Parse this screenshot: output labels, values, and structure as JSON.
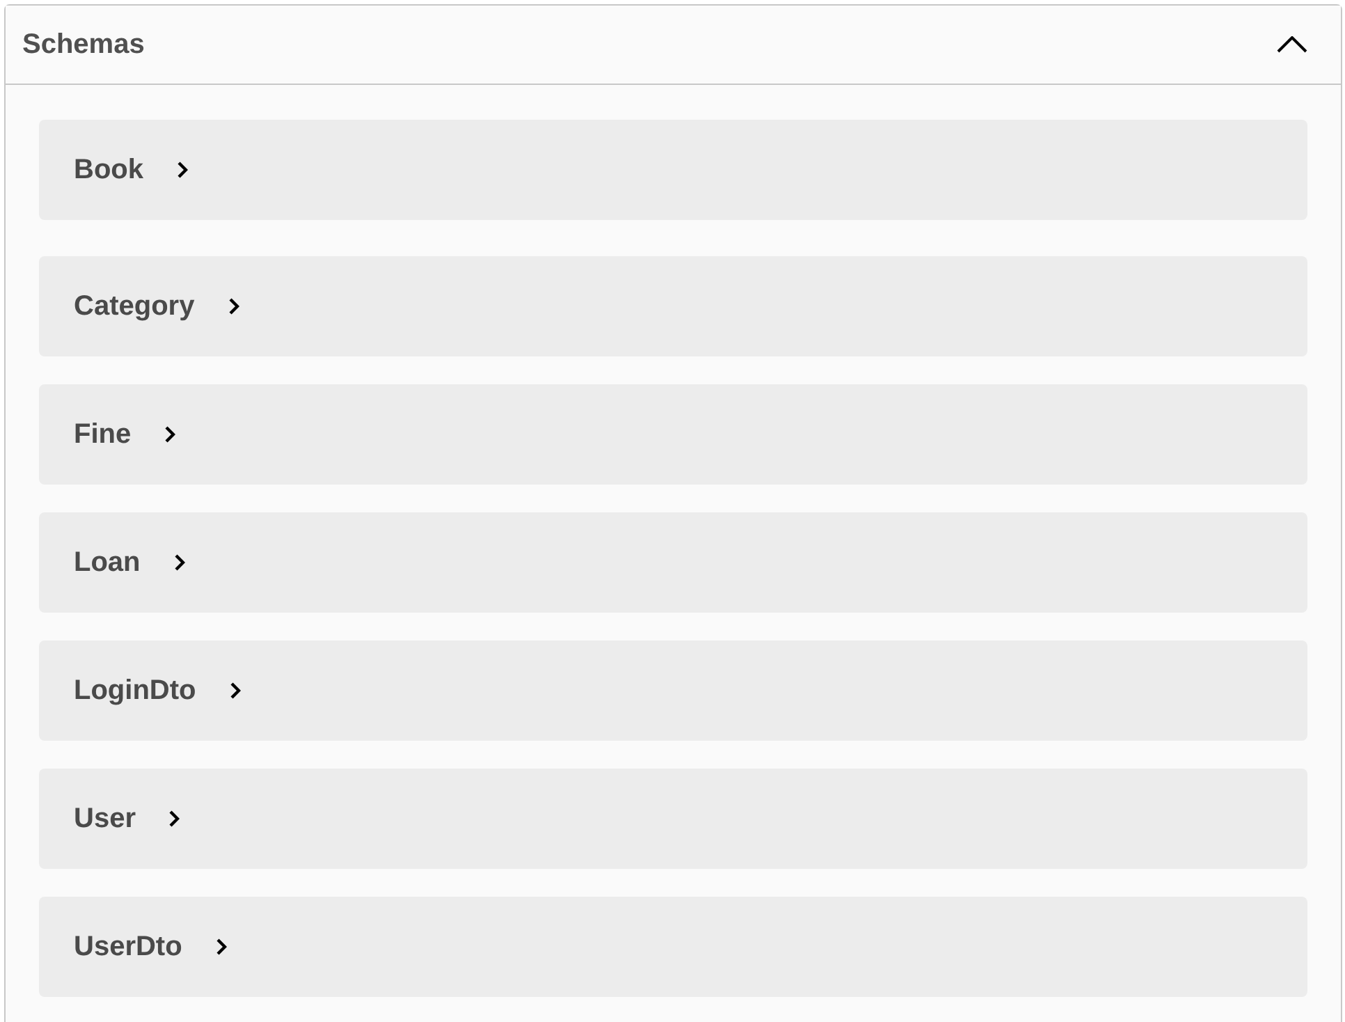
{
  "section": {
    "title": "Schemas",
    "expanded": true
  },
  "schemas": [
    {
      "name": "Book",
      "expanded": false
    },
    {
      "name": "Category",
      "expanded": false
    },
    {
      "name": "Fine",
      "expanded": false
    },
    {
      "name": "Loan",
      "expanded": false
    },
    {
      "name": "LoginDto",
      "expanded": false
    },
    {
      "name": "User",
      "expanded": false
    },
    {
      "name": "UserDto",
      "expanded": false
    }
  ]
}
